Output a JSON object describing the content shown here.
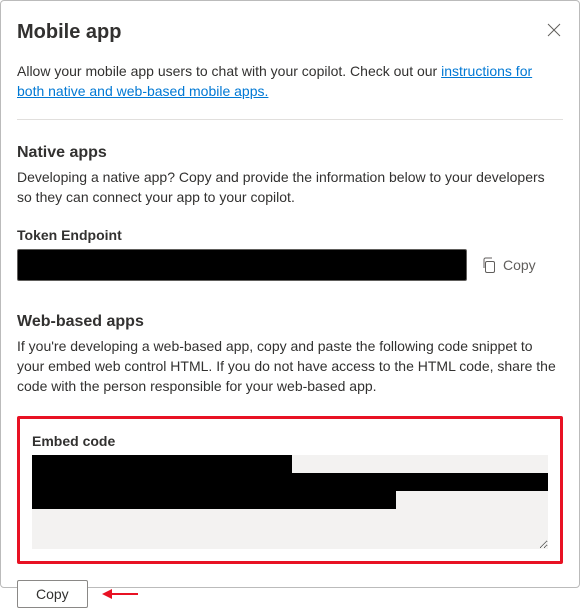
{
  "header": {
    "title": "Mobile app"
  },
  "intro": {
    "text_before_link": "Allow your mobile app users to chat with your copilot. Check out our ",
    "link_text": "instructions for both native and web-based mobile apps."
  },
  "native": {
    "title": "Native apps",
    "desc": "Developing a native app? Copy and provide the information below to your developers so they can connect your app to your copilot.",
    "token_label": "Token Endpoint",
    "token_value": "",
    "copy_label": "Copy"
  },
  "web": {
    "title": "Web-based apps",
    "desc": "If you're developing a web-based app, copy and paste the following code snippet to your embed web control HTML. If you do not have access to the HTML code, share the code with the person responsible for your web-based app.",
    "embed_label": "Embed code",
    "embed_value": "",
    "copy_button": "Copy"
  }
}
